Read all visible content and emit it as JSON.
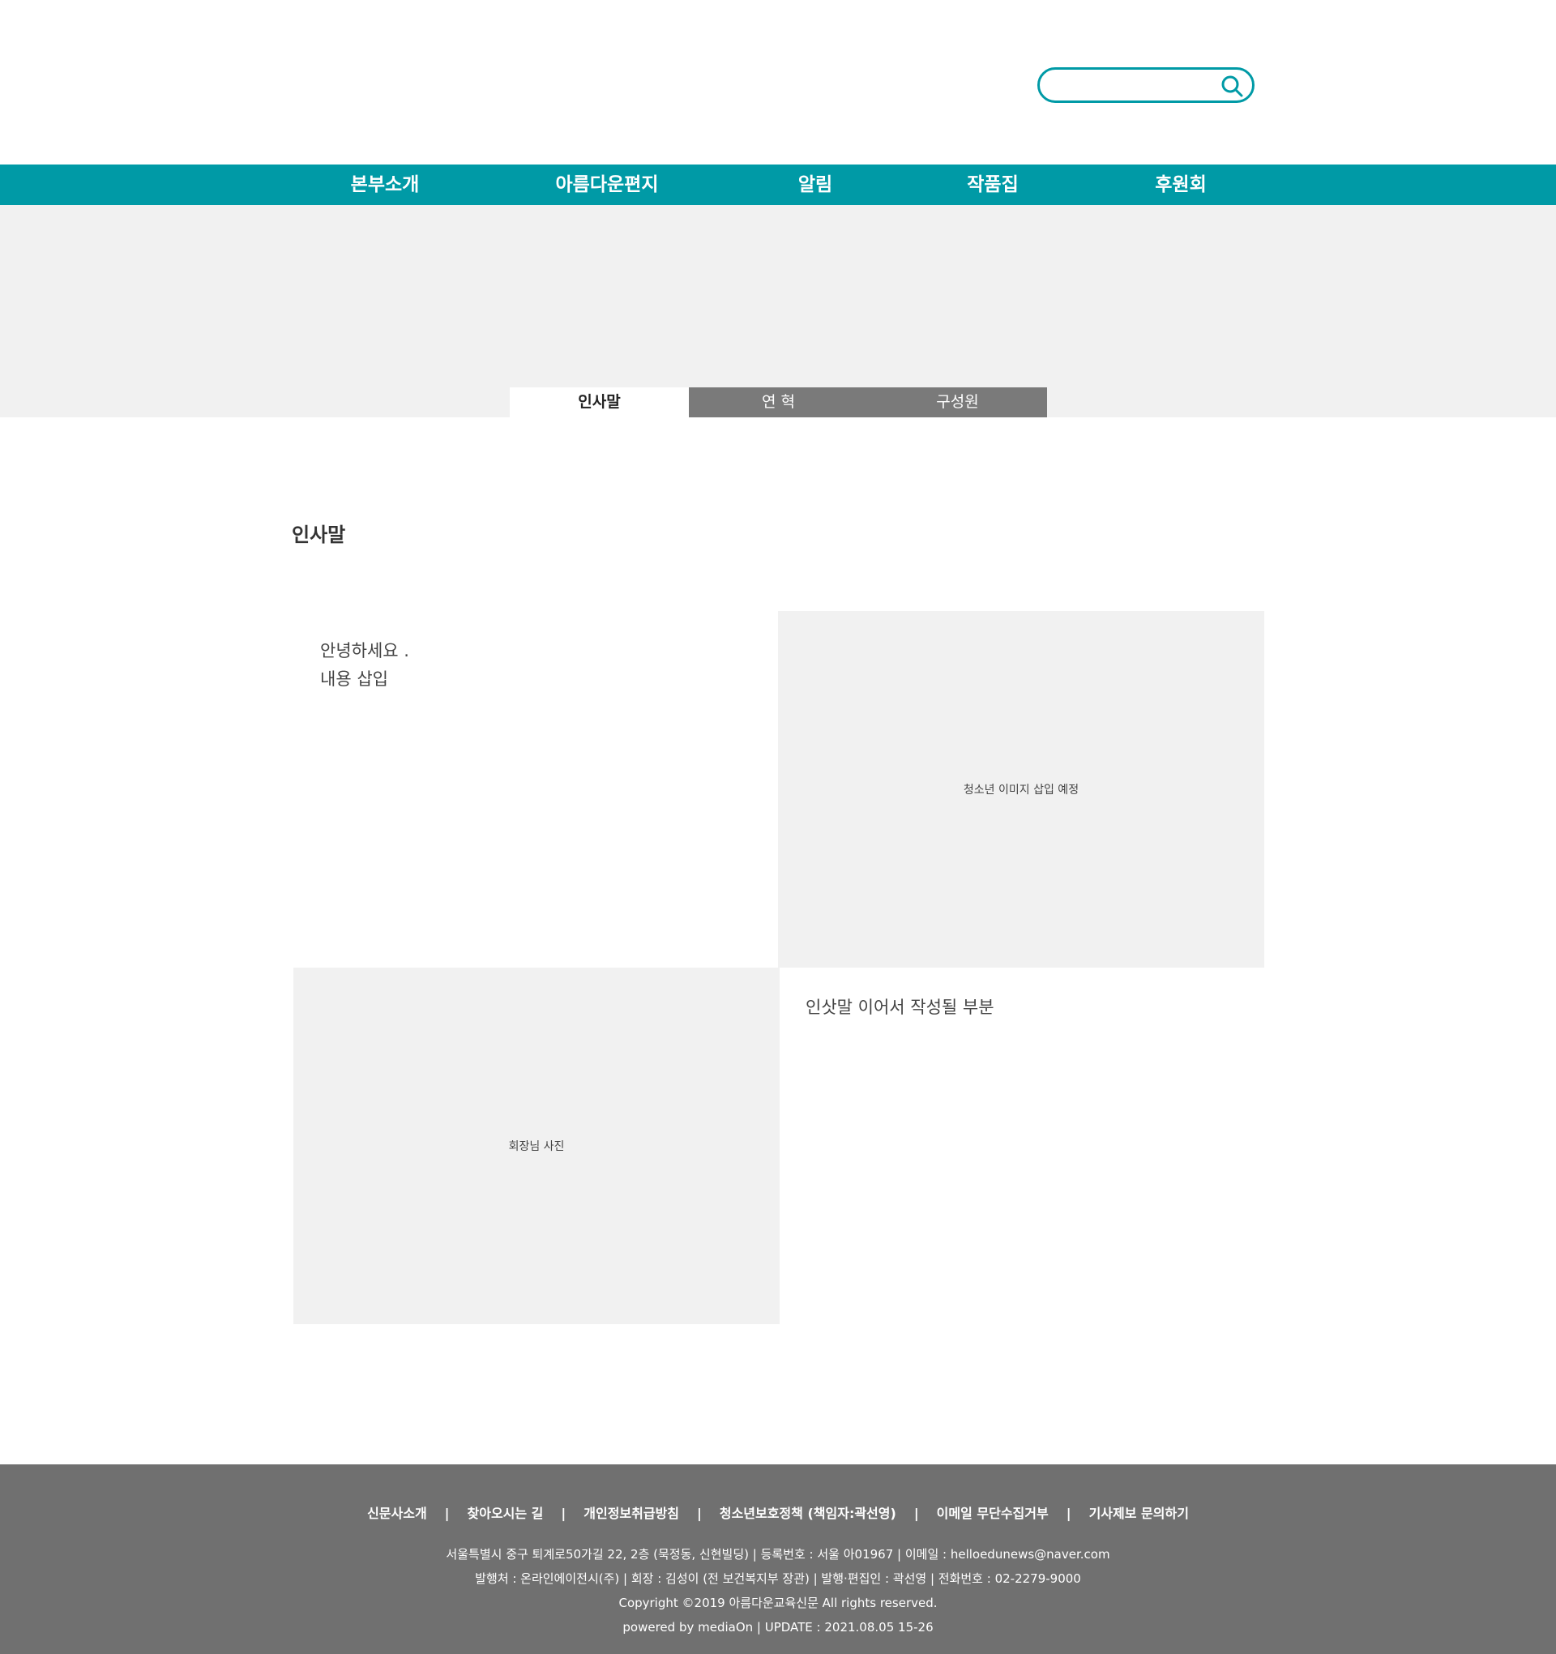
{
  "header": {
    "search": {
      "placeholder": "",
      "value": "",
      "icon": "search-icon"
    }
  },
  "nav": {
    "items": [
      {
        "label": "본부소개"
      },
      {
        "label": "아름다운편지"
      },
      {
        "label": "알림"
      },
      {
        "label": "작품집"
      },
      {
        "label": "후원회"
      }
    ]
  },
  "subtabs": {
    "items": [
      {
        "label": "인사말",
        "active": true
      },
      {
        "label": "연 혁",
        "active": false
      },
      {
        "label": "구성원",
        "active": false
      }
    ]
  },
  "main": {
    "title": "인사말",
    "intro_line1": "안녕하세요 .",
    "intro_line2": "내용 삽입",
    "image1_placeholder": "청소년 이미지 삽입 예정",
    "image2_placeholder": "회장님 사진",
    "continue_text": "인삿말 이어서 작성될 부분"
  },
  "footer": {
    "links": [
      {
        "label": "신문사소개"
      },
      {
        "label": "찾아오시는 길"
      },
      {
        "label": "개인정보취급방침"
      },
      {
        "label": "청소년보호정책 (책임자:곽선영)"
      },
      {
        "label": "이메일 무단수집거부"
      },
      {
        "label": "기사제보 문의하기"
      }
    ],
    "separator": "|",
    "address_line": "서울특별시 중구 퇴계로50가길 22, 2층 (묵정동, 신현빌딩) | 등록번호 : 서울 아01967 | 이메일 : helloedunews@naver.com",
    "publisher_line": "발행처 : 온라인에이전시(주) | 회장 : 김성이 (전 보건복지부 장관) | 발행·편집인 : 곽선영 | 전화번호 : 02-2279-9000",
    "copyright": "Copyright ©2019 아름다운교육신문 All rights reserved.",
    "powered": "powered by mediaOn | UPDATE : 2021.08.05 15-26"
  },
  "colors": {
    "brand": "#009aa6",
    "banner_bg": "#f1f1f1",
    "tab_inactive": "#7a7a7a",
    "footer_bg": "#707070"
  }
}
